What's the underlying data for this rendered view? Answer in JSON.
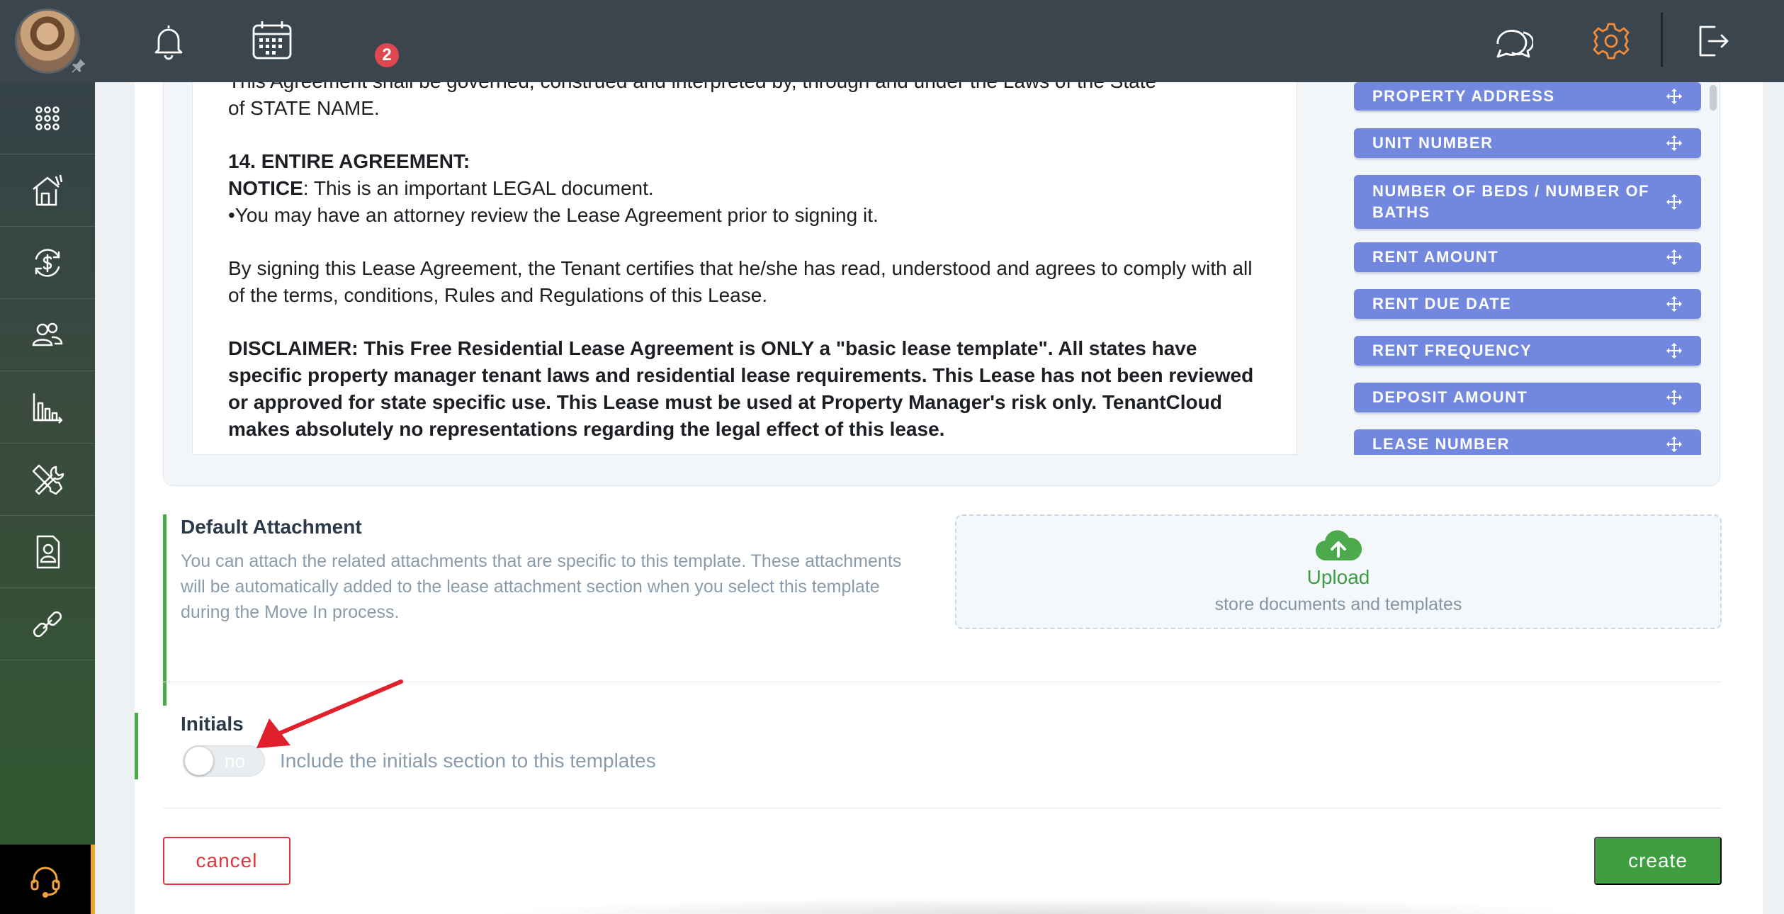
{
  "topbar": {
    "calendar_badge": "2",
    "icons": [
      "bell-icon",
      "calendar-icon",
      "chat-icon",
      "gear-icon",
      "logout-icon"
    ],
    "accent_color": "#f28c3b"
  },
  "sidebar": {
    "items": [
      "apps-grid-icon",
      "properties-icon",
      "accounting-icon",
      "people-icon",
      "reports-icon",
      "maintenance-icon",
      "documents-icon",
      "integrations-icon"
    ],
    "support_icon": "headset-icon"
  },
  "document": {
    "paragraphs": [
      {
        "text": "This Agreement shall be governed, construed and interpreted by, through and under the Laws of the State"
      },
      {
        "text": "of STATE NAME."
      },
      {
        "heading": "14. ENTIRE AGREEMENT:"
      },
      {
        "bold": "NOTICE",
        "text": ": This is an important LEGAL document."
      },
      {
        "text": "•You may have an attorney review the Lease Agreement prior to signing it."
      },
      {
        "text": "By signing this Lease Agreement, the Tenant certifies that he/she has read, understood and agrees to comply with all of the terms, conditions, Rules and Regulations of this Lease."
      },
      {
        "heading": "DISCLAIMER: This Free Residential Lease Agreement is ONLY a \"basic lease template\". All states have specific property manager tenant laws and residential lease requirements. This Lease has not been reviewed or approved for state specific use. This Lease must be used at Property Manager's risk only. TenantCloud makes absolutely no representations regarding the legal effect of this lease."
      }
    ]
  },
  "fields": [
    "PROPERTY ADDRESS",
    "UNIT NUMBER",
    "NUMBER OF BEDS / NUMBER OF BATHS",
    "RENT AMOUNT",
    "RENT DUE DATE",
    "RENT FREQUENCY",
    "DEPOSIT AMOUNT",
    "LEASE NUMBER"
  ],
  "attachment": {
    "title": "Default Attachment",
    "description": "You can attach the related attachments that are specific to this template. These attachments will be automatically added to the lease attachment section when you select this template during the Move In process.",
    "upload_title": "Upload",
    "upload_subtitle": "store documents and templates"
  },
  "initials": {
    "title": "Initials",
    "toggle_value": "no",
    "toggle_label": "Include the initials section to this templates"
  },
  "actions": {
    "cancel": "cancel",
    "create": "create"
  },
  "colors": {
    "field_chip": "#7288df",
    "section_bar": "#4caa4d",
    "create_button": "#3f9e40",
    "cancel_button": "#d9363e",
    "annotation_arrow": "#e0202a"
  }
}
